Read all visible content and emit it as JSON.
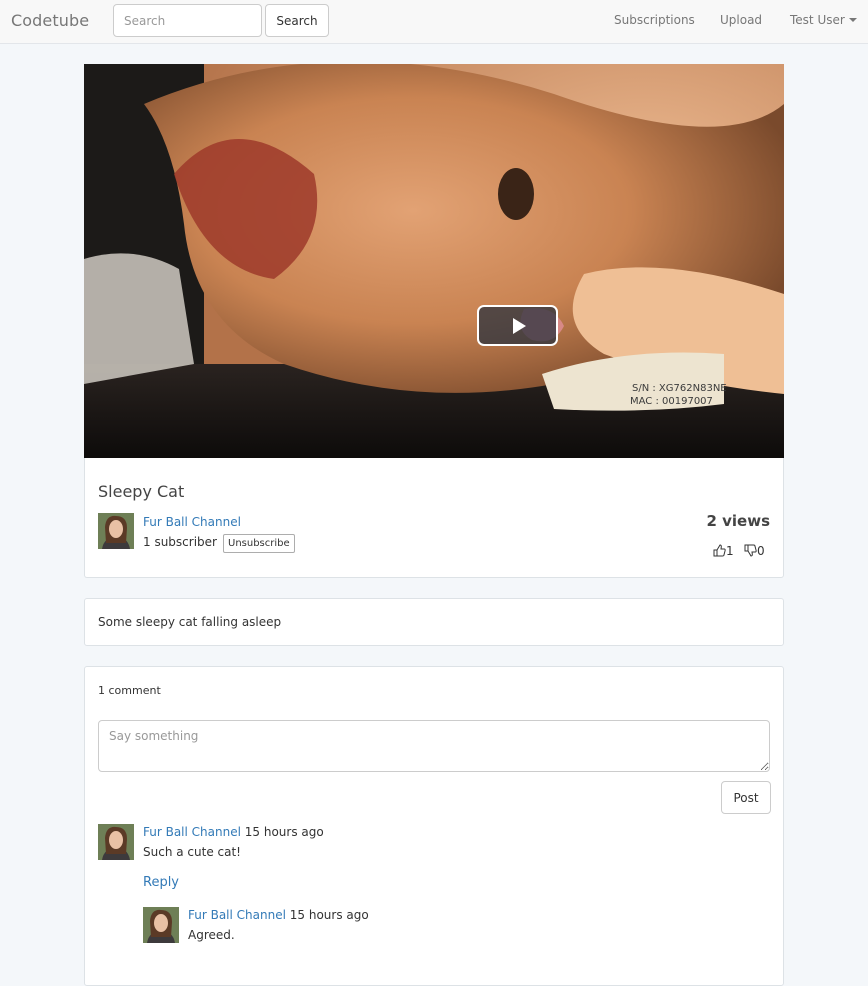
{
  "navbar": {
    "brand": "Codetube",
    "search_placeholder": "Search",
    "search_button": "Search",
    "links": [
      "Subscriptions",
      "Upload"
    ],
    "user_menu": "Test User"
  },
  "video": {
    "title": "Sleepy Cat",
    "channel": "Fur Ball Channel",
    "subscribers": "1 subscriber",
    "unsubscribe_label": "Unsubscribe",
    "views": "2 views",
    "likes": "1",
    "dislikes": "0",
    "description": "Some sleepy cat falling asleep",
    "thumbnail_text": [
      "S/N : XG762N83NE",
      "MAC : 00197007"
    ]
  },
  "comments": {
    "count_label": "1 comment",
    "input_placeholder": "Say something",
    "post_label": "Post",
    "reply_label": "Reply",
    "items": [
      {
        "author": "Fur Ball Channel",
        "time": "15 hours ago",
        "body": "Such a cute cat!"
      },
      {
        "author": "Fur Ball Channel",
        "time": "15 hours ago",
        "body": "Agreed."
      }
    ]
  },
  "colors": {
    "link": "#337ab7",
    "navbar_bg": "#f8f8f8",
    "page_bg": "#f4f7fa"
  },
  "icons": [
    "play-icon",
    "thumbs-up-icon",
    "thumbs-down-icon",
    "caret-down-icon"
  ]
}
